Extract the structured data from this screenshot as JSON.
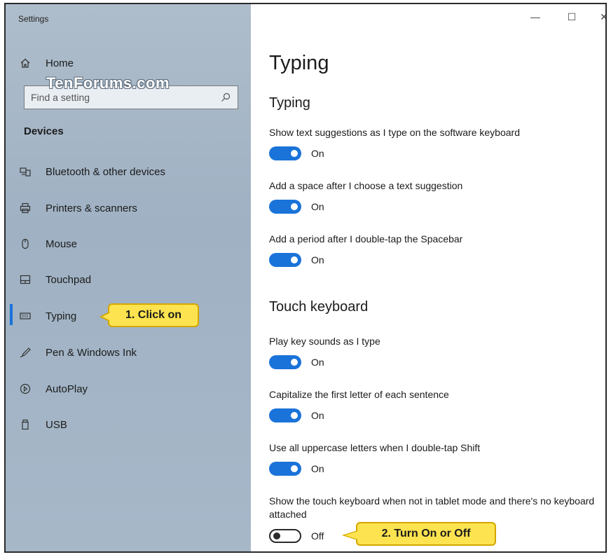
{
  "window": {
    "app_title": "Settings",
    "minimize": "—",
    "maximize": "☐",
    "close": "✕"
  },
  "sidebar": {
    "home_label": "Home",
    "search_placeholder": "Find a setting",
    "watermark": "TenForums.com",
    "section": "Devices",
    "items": [
      {
        "label": "Bluetooth & other devices",
        "icon": "bluetooth-devices-icon"
      },
      {
        "label": "Printers & scanners",
        "icon": "printer-icon"
      },
      {
        "label": "Mouse",
        "icon": "mouse-icon"
      },
      {
        "label": "Touchpad",
        "icon": "touchpad-icon"
      },
      {
        "label": "Typing",
        "icon": "keyboard-icon",
        "selected": true
      },
      {
        "label": "Pen & Windows Ink",
        "icon": "pen-icon"
      },
      {
        "label": "AutoPlay",
        "icon": "autoplay-icon"
      },
      {
        "label": "USB",
        "icon": "usb-icon"
      }
    ],
    "callout": "1. Click on"
  },
  "main": {
    "title": "Typing",
    "typing_header": "Typing",
    "typing_settings": [
      {
        "label": "Show text suggestions as I type on the software keyboard",
        "state": "On"
      },
      {
        "label": "Add a space after I choose a text suggestion",
        "state": "On"
      },
      {
        "label": "Add a period after I double-tap the Spacebar",
        "state": "On"
      }
    ],
    "touch_header": "Touch keyboard",
    "touch_settings": [
      {
        "label": "Play key sounds as I type",
        "state": "On"
      },
      {
        "label": "Capitalize the first letter of each sentence",
        "state": "On"
      },
      {
        "label": "Use all uppercase letters when I double-tap Shift",
        "state": "On"
      },
      {
        "label": "Show the touch keyboard when not in tablet mode and there's no keyboard attached",
        "state": "Off"
      }
    ],
    "callout": "2. Turn On or Off"
  },
  "colors": {
    "accent": "#1a73d9",
    "sidebar_bg": "#a6b8c8",
    "callout_bg": "#fde34f"
  }
}
